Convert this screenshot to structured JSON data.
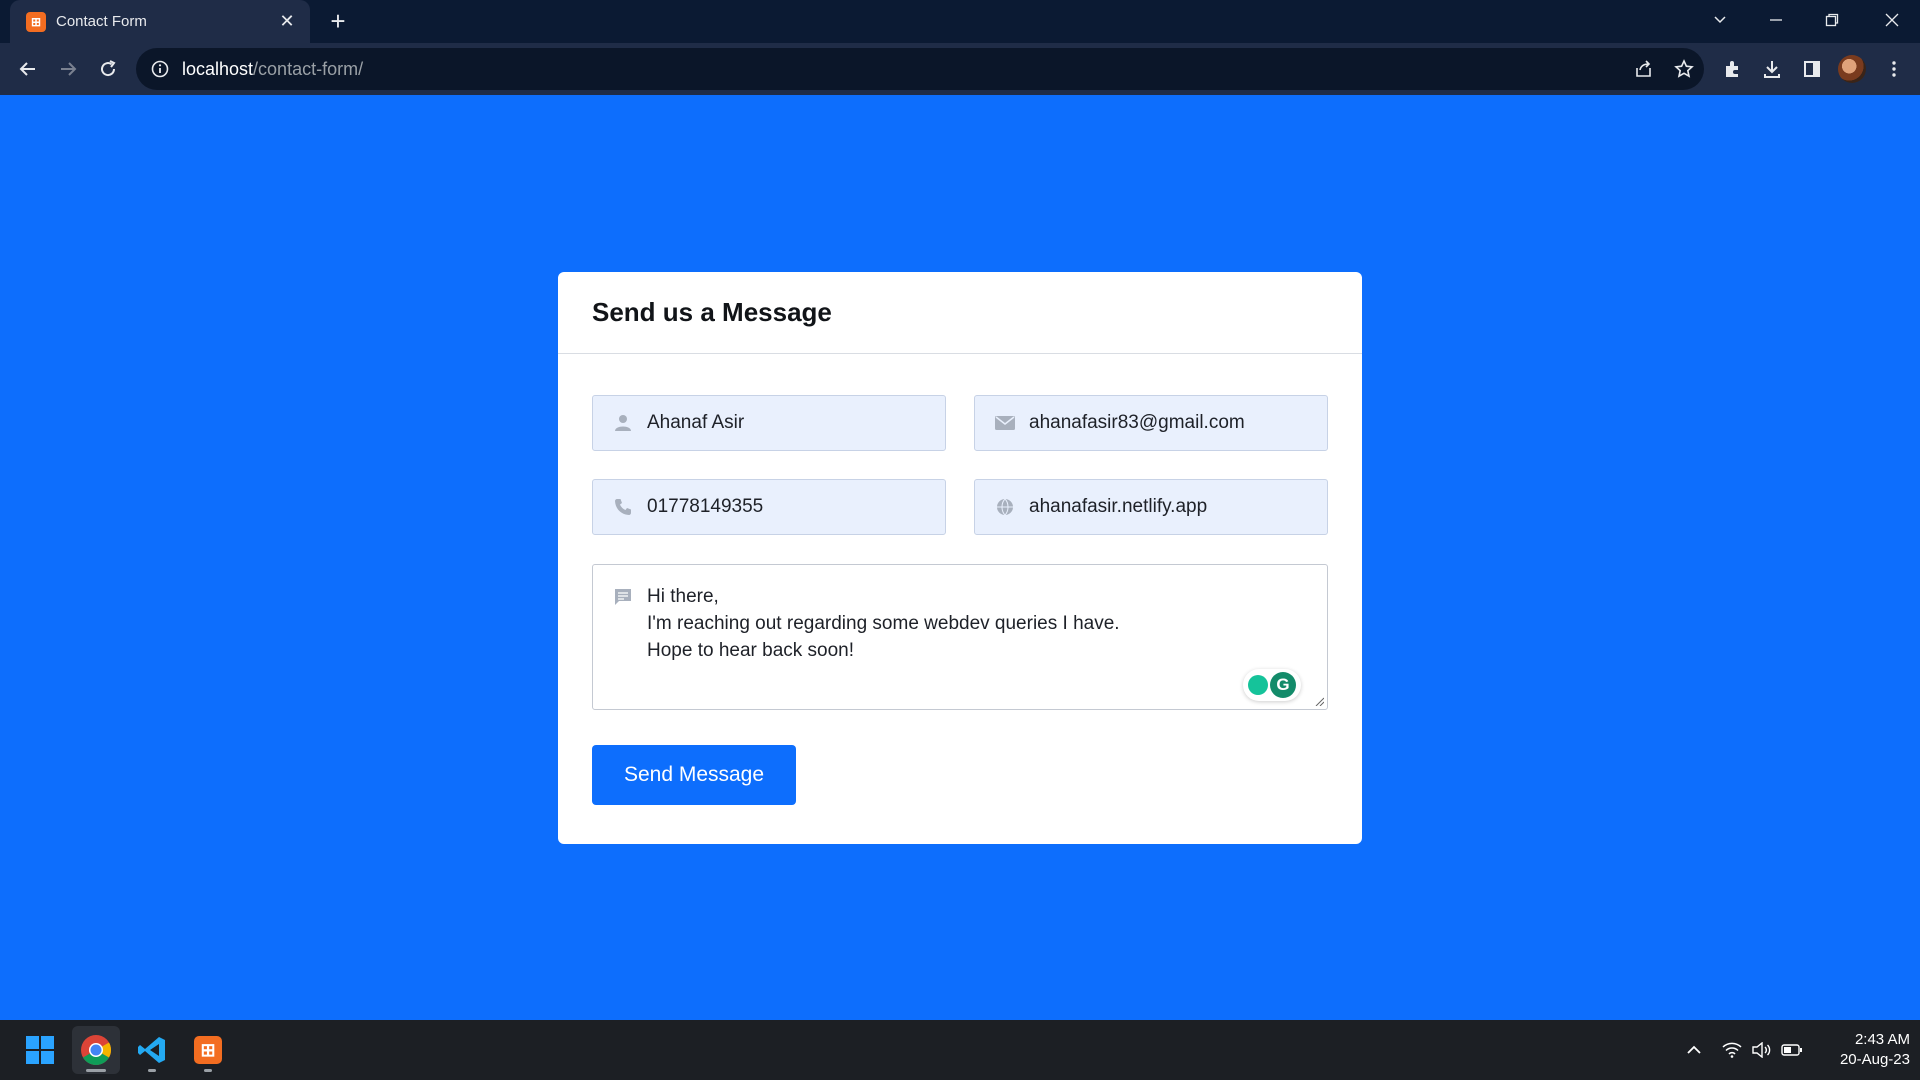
{
  "browser": {
    "tab": {
      "title": "Contact Form",
      "favicon_label": "⊞"
    },
    "address": {
      "host": "localhost",
      "path": "/contact-form/"
    },
    "icons": [
      "back-icon",
      "forward-icon",
      "reload-icon",
      "info-icon",
      "share-icon",
      "bookmark-star-icon",
      "extensions-icon",
      "download-icon",
      "side-panel-icon",
      "avatar",
      "menu-icon"
    ]
  },
  "form": {
    "title": "Send us a Message",
    "name": {
      "value": "Ahanaf Asir",
      "icon": "user-icon"
    },
    "email": {
      "value": "ahanafasir83@gmail.com",
      "icon": "envelope-icon"
    },
    "phone": {
      "value": "01778149355",
      "icon": "phone-icon"
    },
    "website": {
      "value": "ahanafasir.netlify.app",
      "icon": "globe-icon"
    },
    "message": {
      "lines": [
        "Hi there,",
        "I'm reaching out regarding some webdev queries I have.",
        "Hope to hear back soon!"
      ],
      "icon": "message-icon",
      "grammarly_letter": "G"
    },
    "submit_label": "Send Message"
  },
  "taskbar": {
    "apps": [
      "windows-start-icon",
      "chrome-icon",
      "vscode-icon",
      "xampp-icon"
    ],
    "xampp_label": "⊞",
    "time": "2:43 AM",
    "date": "20-Aug-23"
  },
  "colors": {
    "page_bg": "#0d6efd",
    "button_bg": "#0d6efd",
    "field_bg": "#e9f0fd",
    "chrome_dark": "#0b1a33"
  }
}
